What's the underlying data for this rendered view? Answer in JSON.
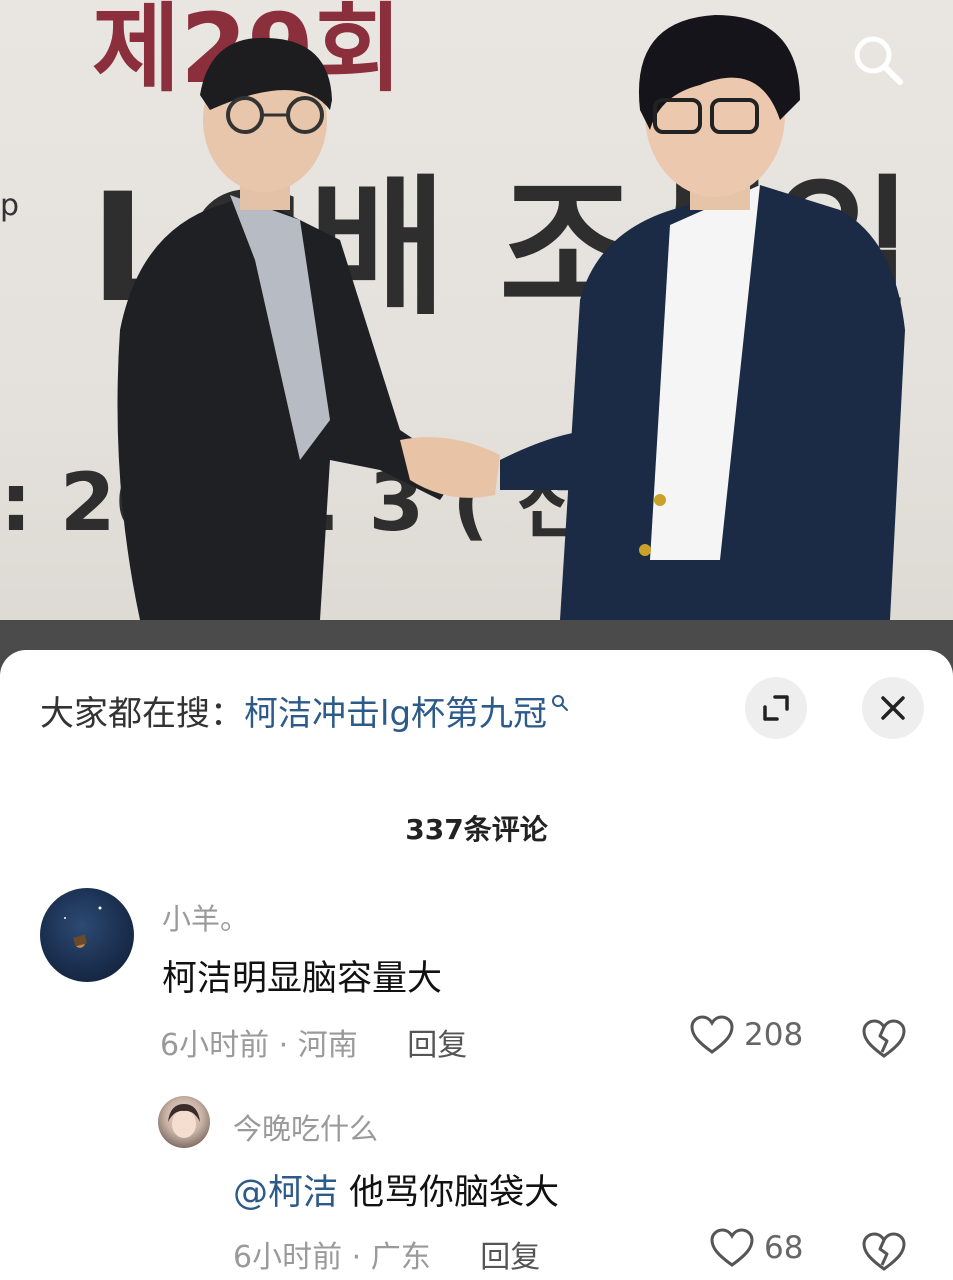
{
  "photo": {
    "backdrop_text": {
      "top": "제29회",
      "middle": "LG배 조선일",
      "bottom": ": 202  9. 3 (   전:",
      "left_edge": "p"
    }
  },
  "hot_search": {
    "prefix": "大家都在搜：",
    "term": "柯洁冲击lg杯第九冠"
  },
  "comments_header": {
    "count_label": "337条评论"
  },
  "comments": [
    {
      "username": "小羊。",
      "text": "柯洁明显脑容量大",
      "time": "6小时前",
      "separator": " · ",
      "location": "河南",
      "reply_label": "回复",
      "likes": "208"
    },
    {
      "username": "今晚吃什么",
      "mention": "@柯洁",
      "text": " 他骂你脑袋大",
      "time": "6小时前",
      "separator": " · ",
      "location": "广东",
      "reply_label": "回复",
      "likes": "68"
    }
  ],
  "icons": {
    "search": "search-icon",
    "expand": "expand-icon",
    "close": "close-icon",
    "like": "heart-outline-icon",
    "dislike": "broken-heart-icon"
  },
  "colors": {
    "link_blue": "#2c5a8a",
    "muted_gray": "#9a9a9a",
    "sign_red": "#8c2f3c"
  }
}
